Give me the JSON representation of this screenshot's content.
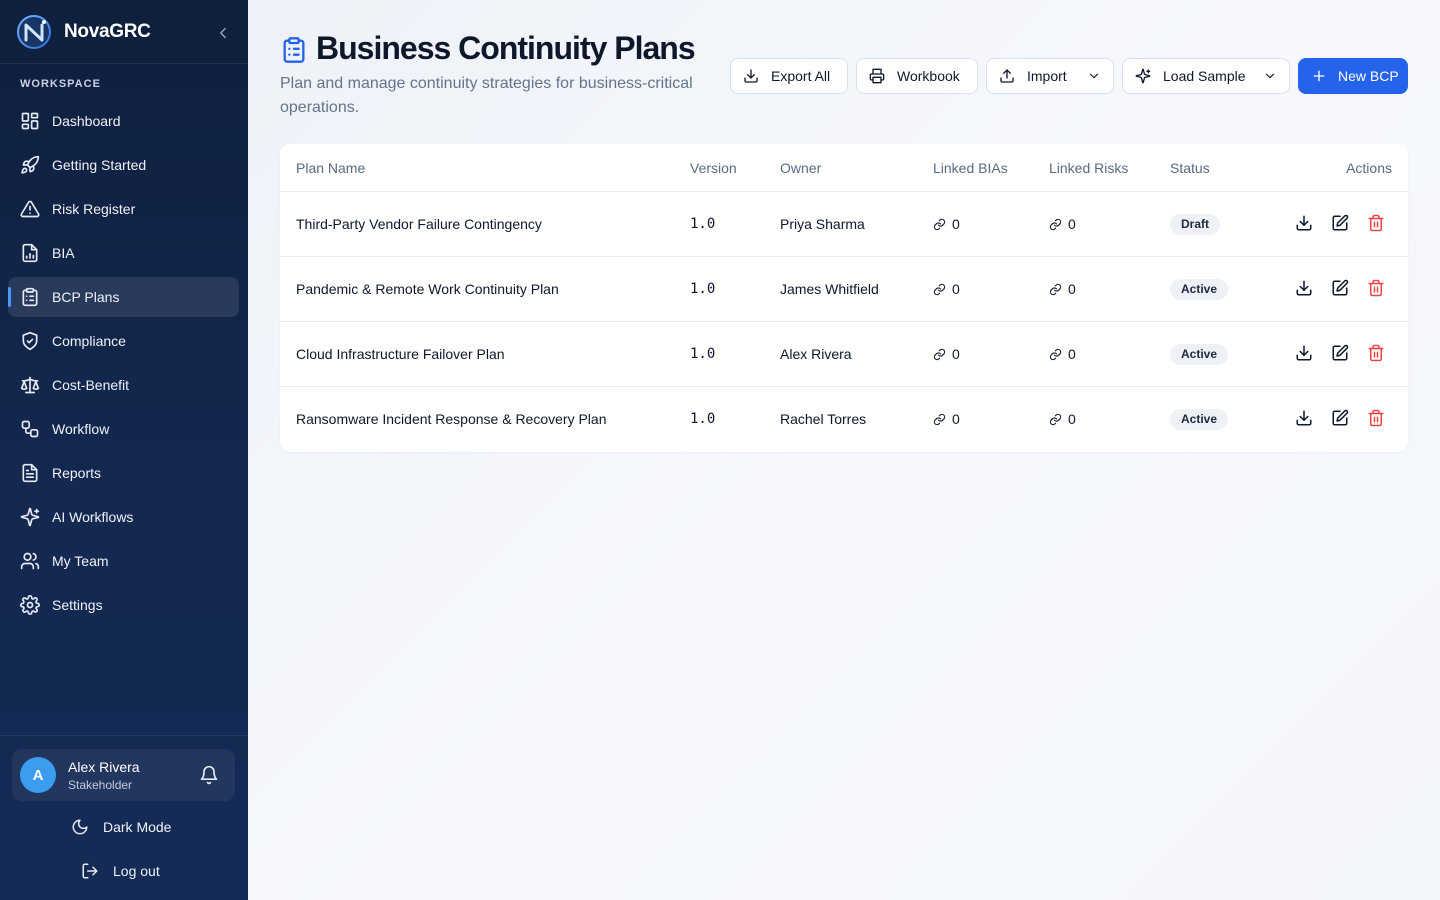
{
  "brand": {
    "name": "NovaGRC"
  },
  "sidebar": {
    "section_label": "WORKSPACE",
    "items": [
      {
        "label": "Dashboard",
        "icon": "dashboard-icon"
      },
      {
        "label": "Getting Started",
        "icon": "rocket-icon"
      },
      {
        "label": "Risk Register",
        "icon": "warning-icon"
      },
      {
        "label": "BIA",
        "icon": "file-chart-icon"
      },
      {
        "label": "BCP Plans",
        "icon": "clipboard-icon",
        "active": true
      },
      {
        "label": "Compliance",
        "icon": "shield-check-icon"
      },
      {
        "label": "Cost-Benefit",
        "icon": "scale-icon"
      },
      {
        "label": "Workflow",
        "icon": "workflow-icon"
      },
      {
        "label": "Reports",
        "icon": "report-icon"
      },
      {
        "label": "AI Workflows",
        "icon": "sparkles-icon"
      },
      {
        "label": "My Team",
        "icon": "users-icon"
      },
      {
        "label": "Settings",
        "icon": "gear-icon"
      }
    ],
    "user": {
      "initial": "A",
      "name": "Alex Rivera",
      "role": "Stakeholder"
    },
    "dark_mode_label": "Dark Mode",
    "logout_label": "Log out"
  },
  "page": {
    "title": "Business Continuity Plans",
    "subtitle": "Plan and manage continuity strategies for business-critical operations."
  },
  "toolbar": {
    "export_label": "Export All",
    "workbook_label": "Workbook",
    "import_label": "Import",
    "sample_label": "Load Sample",
    "new_label": "New BCP"
  },
  "table": {
    "headers": {
      "name": "Plan Name",
      "version": "Version",
      "owner": "Owner",
      "bias": "Linked BIAs",
      "risks": "Linked Risks",
      "status": "Status",
      "actions": "Actions"
    },
    "rows": [
      {
        "name": "Third-Party Vendor Failure Contingency",
        "version": "1.0",
        "owner": "Priya Sharma",
        "bias": "0",
        "risks": "0",
        "status": "Draft"
      },
      {
        "name": "Pandemic & Remote Work Continuity Plan",
        "version": "1.0",
        "owner": "James Whitfield",
        "bias": "0",
        "risks": "0",
        "status": "Active"
      },
      {
        "name": "Cloud Infrastructure Failover Plan",
        "version": "1.0",
        "owner": "Alex Rivera",
        "bias": "0",
        "risks": "0",
        "status": "Active"
      },
      {
        "name": "Ransomware Incident Response & Recovery Plan",
        "version": "1.0",
        "owner": "Rachel Torres",
        "bias": "0",
        "risks": "0",
        "status": "Active"
      }
    ]
  },
  "colors": {
    "accent": "#2563eb",
    "sidebar_bg": "#0f1f3d",
    "delete": "#ef4444"
  }
}
